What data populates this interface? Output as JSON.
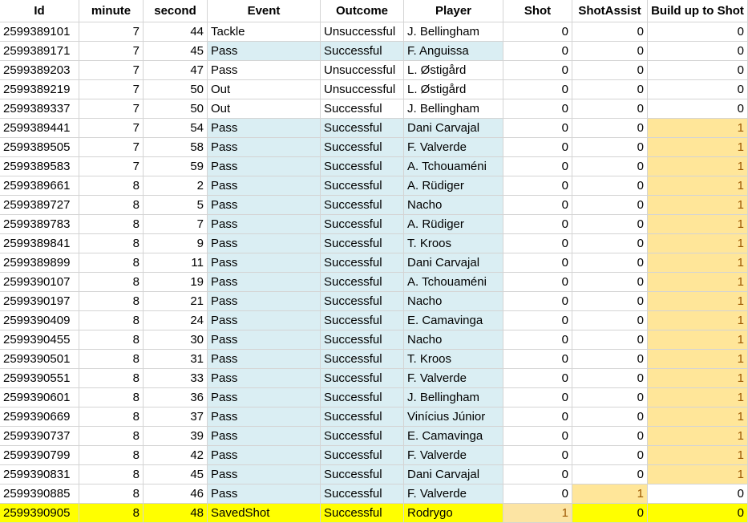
{
  "headers": [
    "Id",
    "minute",
    "second",
    "Event",
    "Outcome",
    "Player",
    "Shot",
    "ShotAssist",
    "Build up to Shot"
  ],
  "rows": [
    {
      "id": "2599389101",
      "minute": "7",
      "second": "44",
      "event": "Tackle",
      "outcome": "Unsuccessful",
      "player": "J. Bellingham",
      "shot": "0",
      "assist": "0",
      "build": "0"
    },
    {
      "id": "2599389171",
      "minute": "7",
      "second": "45",
      "event": "Pass",
      "outcome": "Successful",
      "player": "F. Anguissa",
      "shot": "0",
      "assist": "0",
      "build": "0"
    },
    {
      "id": "2599389203",
      "minute": "7",
      "second": "47",
      "event": "Pass",
      "outcome": "Unsuccessful",
      "player": "L. Østigård",
      "shot": "0",
      "assist": "0",
      "build": "0"
    },
    {
      "id": "2599389219",
      "minute": "7",
      "second": "50",
      "event": "Out",
      "outcome": "Unsuccessful",
      "player": "L. Østigård",
      "shot": "0",
      "assist": "0",
      "build": "0"
    },
    {
      "id": "2599389337",
      "minute": "7",
      "second": "50",
      "event": "Out",
      "outcome": "Successful",
      "player": "J. Bellingham",
      "shot": "0",
      "assist": "0",
      "build": "0"
    },
    {
      "id": "2599389441",
      "minute": "7",
      "second": "54",
      "event": "Pass",
      "outcome": "Successful",
      "player": "Dani Carvajal",
      "shot": "0",
      "assist": "0",
      "build": "1"
    },
    {
      "id": "2599389505",
      "minute": "7",
      "second": "58",
      "event": "Pass",
      "outcome": "Successful",
      "player": "F. Valverde",
      "shot": "0",
      "assist": "0",
      "build": "1"
    },
    {
      "id": "2599389583",
      "minute": "7",
      "second": "59",
      "event": "Pass",
      "outcome": "Successful",
      "player": "A. Tchouaméni",
      "shot": "0",
      "assist": "0",
      "build": "1"
    },
    {
      "id": "2599389661",
      "minute": "8",
      "second": "2",
      "event": "Pass",
      "outcome": "Successful",
      "player": "A. Rüdiger",
      "shot": "0",
      "assist": "0",
      "build": "1"
    },
    {
      "id": "2599389727",
      "minute": "8",
      "second": "5",
      "event": "Pass",
      "outcome": "Successful",
      "player": "Nacho",
      "shot": "0",
      "assist": "0",
      "build": "1"
    },
    {
      "id": "2599389783",
      "minute": "8",
      "second": "7",
      "event": "Pass",
      "outcome": "Successful",
      "player": "A. Rüdiger",
      "shot": "0",
      "assist": "0",
      "build": "1"
    },
    {
      "id": "2599389841",
      "minute": "8",
      "second": "9",
      "event": "Pass",
      "outcome": "Successful",
      "player": "T. Kroos",
      "shot": "0",
      "assist": "0",
      "build": "1"
    },
    {
      "id": "2599389899",
      "minute": "8",
      "second": "11",
      "event": "Pass",
      "outcome": "Successful",
      "player": "Dani Carvajal",
      "shot": "0",
      "assist": "0",
      "build": "1"
    },
    {
      "id": "2599390107",
      "minute": "8",
      "second": "19",
      "event": "Pass",
      "outcome": "Successful",
      "player": "A. Tchouaméni",
      "shot": "0",
      "assist": "0",
      "build": "1"
    },
    {
      "id": "2599390197",
      "minute": "8",
      "second": "21",
      "event": "Pass",
      "outcome": "Successful",
      "player": "Nacho",
      "shot": "0",
      "assist": "0",
      "build": "1"
    },
    {
      "id": "2599390409",
      "minute": "8",
      "second": "24",
      "event": "Pass",
      "outcome": "Successful",
      "player": "E. Camavinga",
      "shot": "0",
      "assist": "0",
      "build": "1"
    },
    {
      "id": "2599390455",
      "minute": "8",
      "second": "30",
      "event": "Pass",
      "outcome": "Successful",
      "player": "Nacho",
      "shot": "0",
      "assist": "0",
      "build": "1"
    },
    {
      "id": "2599390501",
      "minute": "8",
      "second": "31",
      "event": "Pass",
      "outcome": "Successful",
      "player": "T. Kroos",
      "shot": "0",
      "assist": "0",
      "build": "1"
    },
    {
      "id": "2599390551",
      "minute": "8",
      "second": "33",
      "event": "Pass",
      "outcome": "Successful",
      "player": "F. Valverde",
      "shot": "0",
      "assist": "0",
      "build": "1"
    },
    {
      "id": "2599390601",
      "minute": "8",
      "second": "36",
      "event": "Pass",
      "outcome": "Successful",
      "player": "J. Bellingham",
      "shot": "0",
      "assist": "0",
      "build": "1"
    },
    {
      "id": "2599390669",
      "minute": "8",
      "second": "37",
      "event": "Pass",
      "outcome": "Successful",
      "player": "Vinícius Júnior",
      "shot": "0",
      "assist": "0",
      "build": "1"
    },
    {
      "id": "2599390737",
      "minute": "8",
      "second": "39",
      "event": "Pass",
      "outcome": "Successful",
      "player": "E. Camavinga",
      "shot": "0",
      "assist": "0",
      "build": "1"
    },
    {
      "id": "2599390799",
      "minute": "8",
      "second": "42",
      "event": "Pass",
      "outcome": "Successful",
      "player": "F. Valverde",
      "shot": "0",
      "assist": "0",
      "build": "1"
    },
    {
      "id": "2599390831",
      "minute": "8",
      "second": "45",
      "event": "Pass",
      "outcome": "Successful",
      "player": "Dani Carvajal",
      "shot": "0",
      "assist": "0",
      "build": "1"
    },
    {
      "id": "2599390885",
      "minute": "8",
      "second": "46",
      "event": "Pass",
      "outcome": "Successful",
      "player": "F. Valverde",
      "shot": "0",
      "assist": "1",
      "build": "0"
    },
    {
      "id": "2599390905",
      "minute": "8",
      "second": "48",
      "event": "SavedShot",
      "outcome": "Successful",
      "player": "Rodrygo",
      "shot": "1",
      "assist": "0",
      "build": "0"
    }
  ],
  "colors": {
    "blue_fill": "#daeef3",
    "orange_fill": "#ffe699",
    "orange_text": "#9c5700",
    "highlight_row": "#ffff00",
    "grid_line": "#d4d4d4"
  }
}
